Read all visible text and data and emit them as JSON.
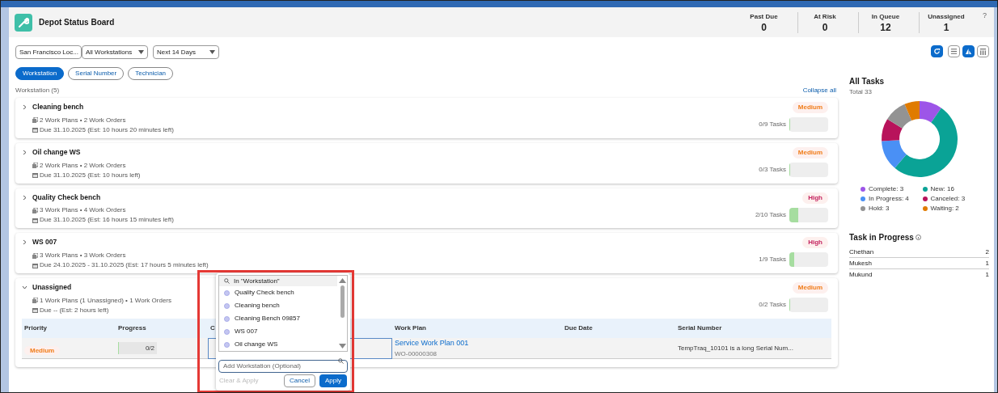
{
  "header": {
    "title": "Depot Status Board",
    "help": "?",
    "stats": [
      {
        "label": "Past Due",
        "value": "0"
      },
      {
        "label": "At Risk",
        "value": "0"
      },
      {
        "label": "In Queue",
        "value": "12"
      },
      {
        "label": "Unassigned",
        "value": "1"
      }
    ]
  },
  "filters": [
    {
      "value": "San Francisco Loc..."
    },
    {
      "value": "All Workstations"
    },
    {
      "value": "Next 14 Days"
    }
  ],
  "views": [
    {
      "kind": "refresh",
      "selected": true
    },
    {
      "kind": "list",
      "selected": false
    },
    {
      "kind": "chart",
      "selected": true
    },
    {
      "kind": "grid",
      "selected": false
    }
  ],
  "group_tabs": [
    {
      "label": "Workstation",
      "selected": true
    },
    {
      "label": "Serial Number",
      "selected": false
    },
    {
      "label": "Technician",
      "selected": false
    }
  ],
  "section": {
    "title": "Workstation (5)",
    "collapse": "Collapse all"
  },
  "workstations": [
    {
      "name": "Cleaning bench",
      "expanded": false,
      "plans": "2 Work Plans • 2 Work Orders",
      "due": "Due 31.10.2025 (Est: 10 hours 20 minutes left)",
      "priority": "Medium",
      "color": "#f07d1a",
      "tasks": "0/9 Tasks",
      "level": 0
    },
    {
      "name": "Oil change WS",
      "expanded": false,
      "plans": "2 Work Plans • 2 Work Orders",
      "due": "Due 31.10.2025 (Est: 10 hours left)",
      "priority": "Medium",
      "color": "#f07d1a",
      "tasks": "0/3 Tasks",
      "level": 0
    },
    {
      "name": "Quality Check bench",
      "expanded": false,
      "plans": "3 Work Plans • 4 Work Orders",
      "due": "Due 31.10.2025 (Est: 16 hours 15 minutes left)",
      "priority": "High",
      "color": "#c4245f",
      "tasks": "2/10 Tasks",
      "level": 0.2
    },
    {
      "name": "WS 007",
      "expanded": false,
      "plans": "3 Work Plans • 3 Work Orders",
      "due": "Due 24.10.2025 - 31.10.2025 (Est: 17 hours 5 minutes left)",
      "priority": "High",
      "color": "#c4245f",
      "tasks": "1/9 Tasks",
      "level": 0.11
    },
    {
      "name": "Unassigned",
      "expanded": true,
      "plans": "1 Work Plans (1 Unassigned) • 1 Work Orders",
      "due": "Due -- (Est: 2 hours left)",
      "priority": "Medium",
      "color": "#f07d1a",
      "tasks": "0/2 Tasks",
      "level": 0,
      "table": {
        "columns": [
          "Priority",
          "Progress",
          "C",
          "Work Plan",
          "Due Date",
          "Serial Number"
        ],
        "rows": [
          {
            "priority": "Medium",
            "color": "#f07d1a",
            "progress": "0/2",
            "level": 0,
            "work_plan": "Service Work Plan 001",
            "work_order": "WO-00000308",
            "serial": "TempTraq_10101 is a long Serial Num..."
          }
        ]
      }
    }
  ],
  "dropdown": {
    "search": "In \"Workstation\"",
    "options": [
      "Quality Check bench",
      "Cleaning bench",
      "Cleaning Bench 09857",
      "WS 007",
      "Oil change WS"
    ],
    "placeholder": "Add Workstation (Optional)",
    "clear": {
      "label": "Clear & Apply",
      "disabled": true
    },
    "cancel": "Cancel",
    "apply": "Apply"
  },
  "all_tasks": {
    "title": "All Tasks",
    "total": "Total 33",
    "chart_data": {
      "type": "donut",
      "categories": [
        "Complete: 3",
        "New: 16",
        "In Progress: 4",
        "Canceled: 3",
        "Hold: 3",
        "Waiting: 2"
      ],
      "values": [
        3,
        16,
        4,
        3,
        3,
        2
      ]
    },
    "legend": [
      {
        "color": "#9d55e8"
      },
      {
        "color": "#0aa396"
      },
      {
        "color": "#4a90f5"
      },
      {
        "color": "#b8135b"
      },
      {
        "color": "#939393"
      },
      {
        "color": "#e07b00"
      }
    ]
  },
  "in_progress": {
    "title": "Task in Progress",
    "rows": [
      {
        "name": "Chethan",
        "count": "2"
      },
      {
        "name": "Mukesh",
        "count": "1"
      },
      {
        "name": "Mukund",
        "count": "1"
      }
    ]
  }
}
